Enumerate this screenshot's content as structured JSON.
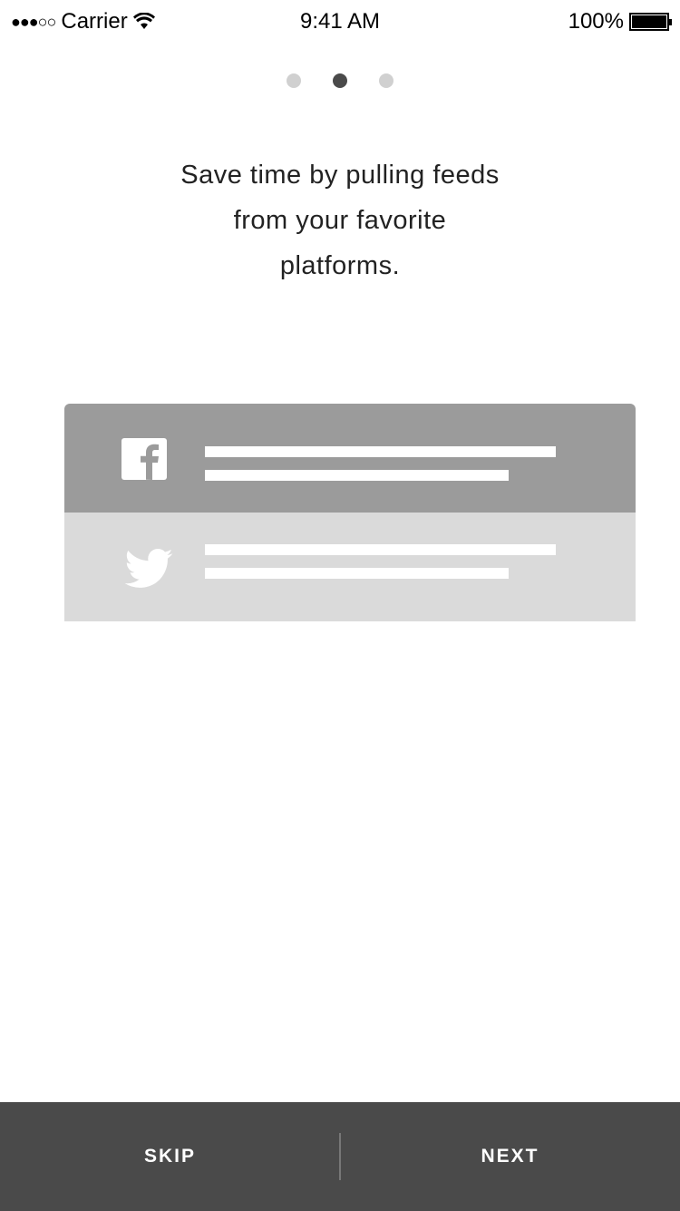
{
  "status_bar": {
    "carrier": "Carrier",
    "time": "9:41 AM",
    "battery": "100%"
  },
  "pager": {
    "count": 3,
    "active_index": 1
  },
  "message": {
    "line1": "Save time by pulling feeds",
    "line2": "from your favorite",
    "line3": "platforms."
  },
  "illustration": {
    "rows": [
      {
        "icon": "facebook-icon"
      },
      {
        "icon": "twitter-icon"
      }
    ]
  },
  "footer": {
    "skip_label": "SKIP",
    "next_label": "NEXT"
  }
}
